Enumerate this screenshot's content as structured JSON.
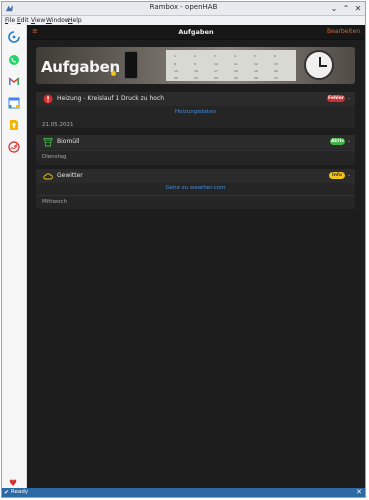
{
  "window": {
    "title": "Rambox - openHAB",
    "controls": [
      "⌄",
      "⌃",
      "✕"
    ]
  },
  "menu": [
    {
      "label": "File",
      "key": "F",
      "rest": "ile"
    },
    {
      "label": "Edit",
      "key": "E",
      "rest": "dit"
    },
    {
      "label": "View",
      "key": "V",
      "rest": "iew"
    },
    {
      "label": "Window",
      "key": "W",
      "rest": "indow"
    },
    {
      "label": "Help",
      "key": "H",
      "rest": "elp"
    }
  ],
  "sidebar": {
    "items": [
      {
        "icon": "openhab-icon",
        "color": "#1f7ed0"
      },
      {
        "icon": "whatsapp-icon",
        "color": "#25d366"
      },
      {
        "icon": "gmail-icon",
        "color": "#ea4335"
      },
      {
        "icon": "google-calendar-icon",
        "color": "#4285f4"
      },
      {
        "icon": "google-keep-icon",
        "color": "#f4b400"
      },
      {
        "icon": "gauge-icon",
        "color": "#d32f2f"
      }
    ],
    "footer_icon": "heart-icon"
  },
  "topbar": {
    "menu_icon": "≡",
    "title": "Aufgaben",
    "edit_label": "Bearbeiten",
    "accent": "#d9662b"
  },
  "banner": {
    "title": "Aufgaben"
  },
  "cards": [
    {
      "icon": "alert-icon",
      "label": "Heizung - Kreislauf 1 Druck zu hoch",
      "badge": "Fehler",
      "badge_color": "#d32f2f",
      "link": "Heizungsdaten",
      "sub": "21.05.2021"
    },
    {
      "icon": "trash-bin-icon",
      "label": "Biomüll",
      "badge": "Aktiv",
      "badge_color": "#43b049",
      "sub": "Dienstag"
    },
    {
      "icon": "cloud-icon",
      "label": "Gewitter",
      "badge": "Info",
      "badge_color": "#f2c318",
      "link": "Gehe zu weather.com",
      "sub": "Mittwoch"
    }
  ],
  "status": {
    "text": "Ready",
    "color": "#2d6aa5"
  }
}
